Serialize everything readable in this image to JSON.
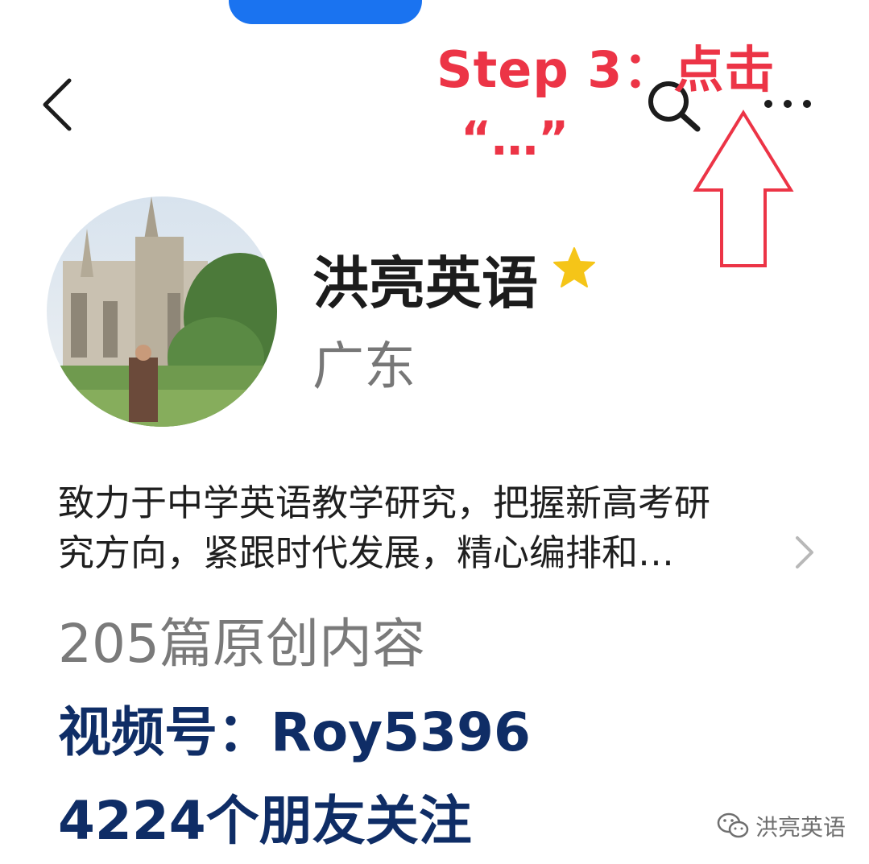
{
  "annotation": {
    "title": "Step 3：点击",
    "subtitle": "“…”",
    "color": "#ec3446"
  },
  "header": {
    "back_icon": "chevron-left-icon",
    "search_icon": "search-icon",
    "more_icon": "more-horizontal-icon"
  },
  "profile": {
    "name": "洪亮英语",
    "verified_icon": "star-icon",
    "region": "广东",
    "description_line1": "致力于中学英语教学研究，把握新高考研",
    "description_line2": "究方向，紧跟时代发展，精心编排和…",
    "articles": "205篇原创内容",
    "channel": "视频号：Roy5396",
    "followers": "4224个朋友关注"
  },
  "watermark": {
    "text": "洪亮英语",
    "icon": "wechat-icon"
  },
  "colors": {
    "accent_blue": "#1a73f0",
    "dark_navy": "#0f2d66",
    "star": "#f5c518"
  }
}
